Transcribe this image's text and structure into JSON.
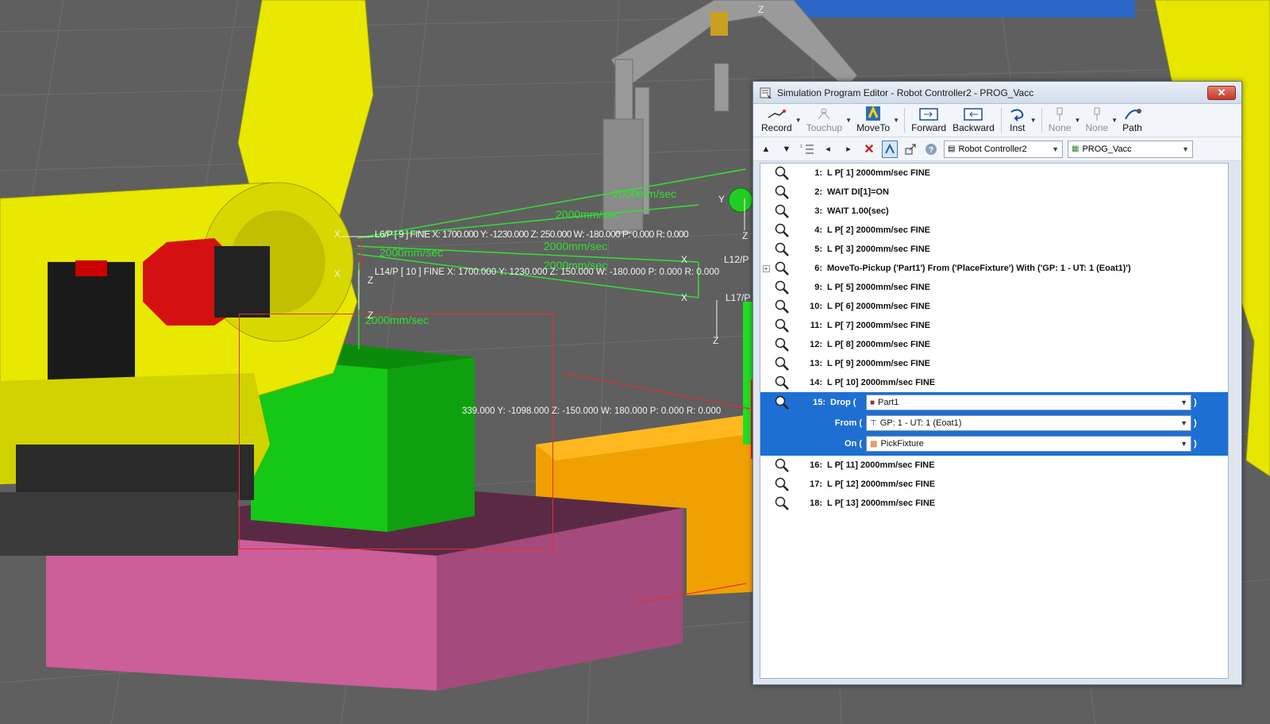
{
  "viewport": {
    "labels": {
      "speed1": "2000mm/sec",
      "speed2": "2000mm/sec",
      "speed3": "2000mm/sec",
      "speed4": "2000mm/sec",
      "speed5": "2000mm/sec",
      "speed6": "2000mm/sec",
      "pos_l14": "L14/P [ 10 ]  FINE X: 1700.000 Y: 1230.000 Z: 150.000 W: -180.000 P: 0.000 R: 0.000",
      "pos_overlap": "L6/P [ 9 ] FINE X: 1700.000 Y: -1230.000 Z: 250.000 W: -180.000 P: 0.000 R: 0.000",
      "pos_drop": "339.000 Y: -1098.000 Z: -150.000 W: 180.000 P: 0.000 R: 0.000",
      "l12": "L12/P",
      "l17": "L17/P"
    },
    "axes": {
      "x": "X",
      "y": "Y",
      "z": "Z"
    }
  },
  "editor": {
    "title": "Simulation Program Editor - Robot Controller2 - PROG_Vacc",
    "close": "✕",
    "toolbar": {
      "record": "Record",
      "touchup": "Touchup",
      "moveto": "MoveTo",
      "forward": "Forward",
      "backward": "Backward",
      "inst": "Inst",
      "none1": "None",
      "none2": "None",
      "path": "Path"
    },
    "controller_combo": "Robot Controller2",
    "program_combo": "PROG_Vacc",
    "lines": [
      {
        "num": "1:",
        "text": "L P[ 1] 2000mm/sec FINE"
      },
      {
        "num": "2:",
        "text": "WAIT DI[1]=ON"
      },
      {
        "num": "3:",
        "text": "WAIT 1.00(sec)"
      },
      {
        "num": "4:",
        "text": "L P[ 2] 2000mm/sec FINE"
      },
      {
        "num": "5:",
        "text": "L P[ 3] 2000mm/sec FINE"
      },
      {
        "num": "6:",
        "text": "MoveTo-Pickup ('Part1') From ('PlaceFixture') With ('GP: 1 - UT: 1 (Eoat1)')"
      },
      {
        "num": "9:",
        "text": "L P[ 5] 2000mm/sec FINE"
      },
      {
        "num": "10:",
        "text": "L P[ 6] 2000mm/sec FINE"
      },
      {
        "num": "11:",
        "text": "L P[ 7] 2000mm/sec FINE"
      },
      {
        "num": "12:",
        "text": "L P[ 8] 2000mm/sec FINE"
      },
      {
        "num": "13:",
        "text": "L P[ 9] 2000mm/sec FINE"
      },
      {
        "num": "14:",
        "text": "L P[ 10] 2000mm/sec FINE"
      }
    ],
    "drop": {
      "num": "15:",
      "keyword": "Drop (",
      "from_label": "From (",
      "on_label": "On (",
      "part": "Part1",
      "tool": "GP: 1 - UT: 1  (Eoat1)",
      "fixture": "PickFixture",
      "close_paren": ")"
    },
    "lines_after": [
      {
        "num": "16:",
        "text": "L P[ 11] 2000mm/sec FINE"
      },
      {
        "num": "17:",
        "text": "L P[ 12] 2000mm/sec FINE"
      },
      {
        "num": "18:",
        "text": "L P[ 13] 2000mm/sec FINE"
      }
    ]
  }
}
